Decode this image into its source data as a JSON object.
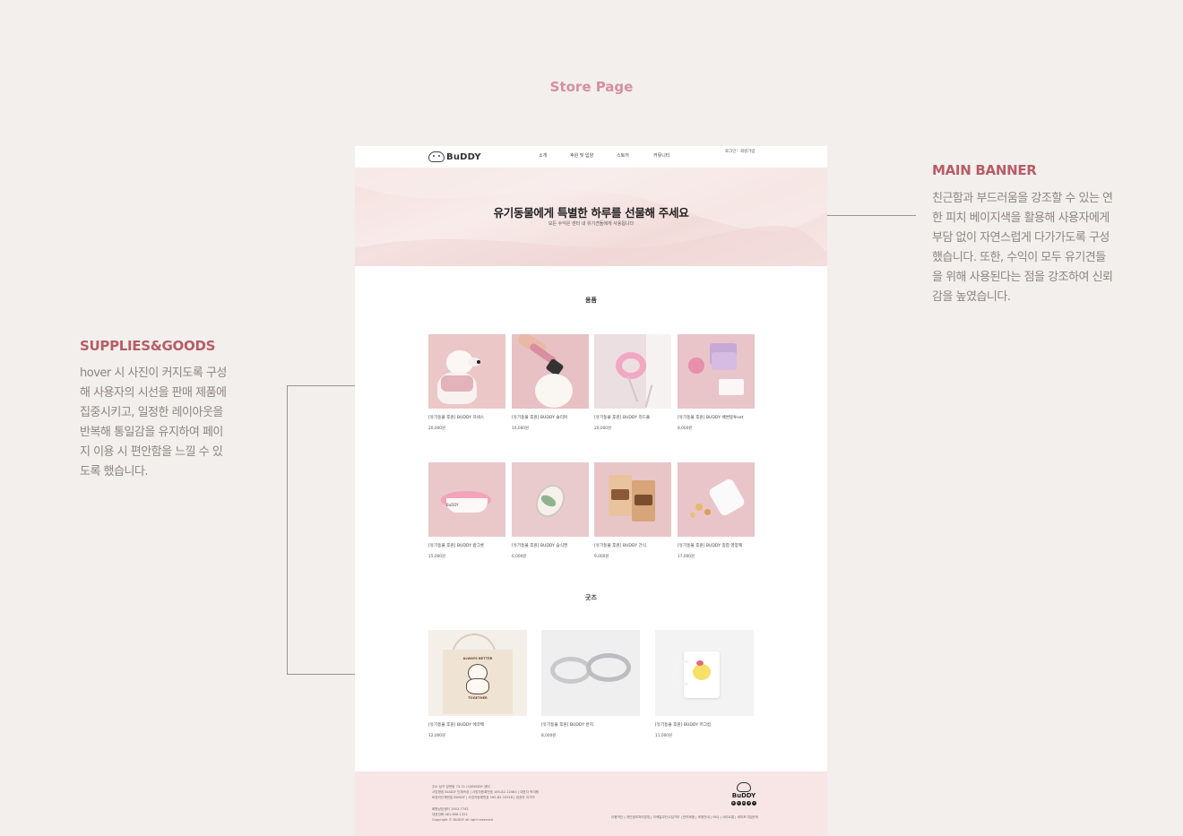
{
  "page_heading": "Store Page",
  "annotations": {
    "main_banner": {
      "title": "MAIN BANNER",
      "lines": [
        "친근함과 부드러움을 강조할 수 있는 연",
        "한 피치 베이지색을 활용해 사용자에게",
        "부담 없이 자연스럽게 다가가도록 구성",
        "했습니다. 또한, 수익이 모두 유기견들",
        "을 위해 사용된다는 점을 강조하여 신뢰",
        "감을 높였습니다."
      ]
    },
    "supplies": {
      "title": "SUPPLIES&GOODS",
      "lines": [
        "hover 시 사진이 커지도록 구성",
        "해 사용자의 시선을 판매 제품에",
        "집중시키고, 일정한 레이아웃을",
        "반복해 통일감을 유지하여 페이",
        "지 이용 시 편안함을 느낄 수 있",
        "도록 했습니다."
      ]
    }
  },
  "site": {
    "logo": "BuDDY",
    "nav": [
      "소개",
      "후원 및 입양",
      "스토어",
      "커뮤니티"
    ],
    "login": "로그인",
    "signup": "회원가입",
    "banner_title": "유기동물에게 특별한 하루를 선물해 주세요",
    "banner_sub": "모든 수익은 센터 내 유기견들에게 사용됩니다",
    "supplies_title": "용품",
    "goods_title": "굿즈",
    "supplies": [
      {
        "name": "[유기동물 후원] BUDDY 하네스",
        "price": "20,000원",
        "icon": "dog-harness-photo"
      },
      {
        "name": "[유기동물 후원] BUDDY 슬리커",
        "price": "10,000원",
        "icon": "slicker-brush-photo"
      },
      {
        "name": "[유기동물 후원] BUDDY 리드줄",
        "price": "20,000원",
        "icon": "leash-photo"
      },
      {
        "name": "[유기동물 후원] BUDDY 배변봉투set",
        "price": "8,000원",
        "icon": "poop-bag-set-photo"
      },
      {
        "name": "[유기동물 후원] BUDDY 밥그릇",
        "price": "15,000원",
        "icon": "food-bowl-photo"
      },
      {
        "name": "[유기동물 후원] BUDDY 습식캔",
        "price": "6,000원",
        "icon": "wet-food-can-photo"
      },
      {
        "name": "[유기동물 후원] BUDDY 간식",
        "price": "9,000원",
        "icon": "snack-pouch-photo"
      },
      {
        "name": "[유기동물 후원] BUDDY 종합 영양제",
        "price": "17,000원",
        "icon": "supplement-bottle-photo"
      }
    ],
    "goods": [
      {
        "name": "[유기동물 후원] BUDDY 에코백",
        "price": "12,000원",
        "icon": "eco-bag-photo",
        "print_top": "ALWAYS BETTER",
        "print_bottom": "TOGETHER"
      },
      {
        "name": "[유기동물 후원] BUDDY 반지",
        "price": "8,000원",
        "icon": "ring-photo"
      },
      {
        "name": "[유기동물 후원] BUDDY 머그컵",
        "price": "11,000원",
        "icon": "mug-photo"
      }
    ],
    "bowl_label": "BuDDY",
    "footer": {
      "lines": [
        "주소  남구 강변동 73-21 (사)BUDDY 센터",
        "사업명칭 BUDDY 단체속성 | 사업자등록번호 165-82-12463 | 대표자 박여원",
        "비영리단체번호 BUDDY | 사업자등록번호 165-82-10318 | 대표자 이기미",
        "회원상담센터 1543-7743",
        "대표전화 061-608-1321",
        "Copyright © BUDDY all right reserved"
      ],
      "links": "이용약관 | 개인정보처리방침 | 이메일무단수집거부 | 반려제품 | 후원안내 | FAQ | 사이트맵 | 세미포기입문제",
      "logo": "BuDDY",
      "logo_dots": [
        "B",
        "U",
        "D",
        "D",
        "Y"
      ]
    }
  },
  "colors": {
    "accent_title": "#b65d68",
    "heading_pink": "#d48fa3",
    "banner_bg": "#f4e0de",
    "footer_bg": "#f8e6e6",
    "page_bg": "#f3efec"
  }
}
